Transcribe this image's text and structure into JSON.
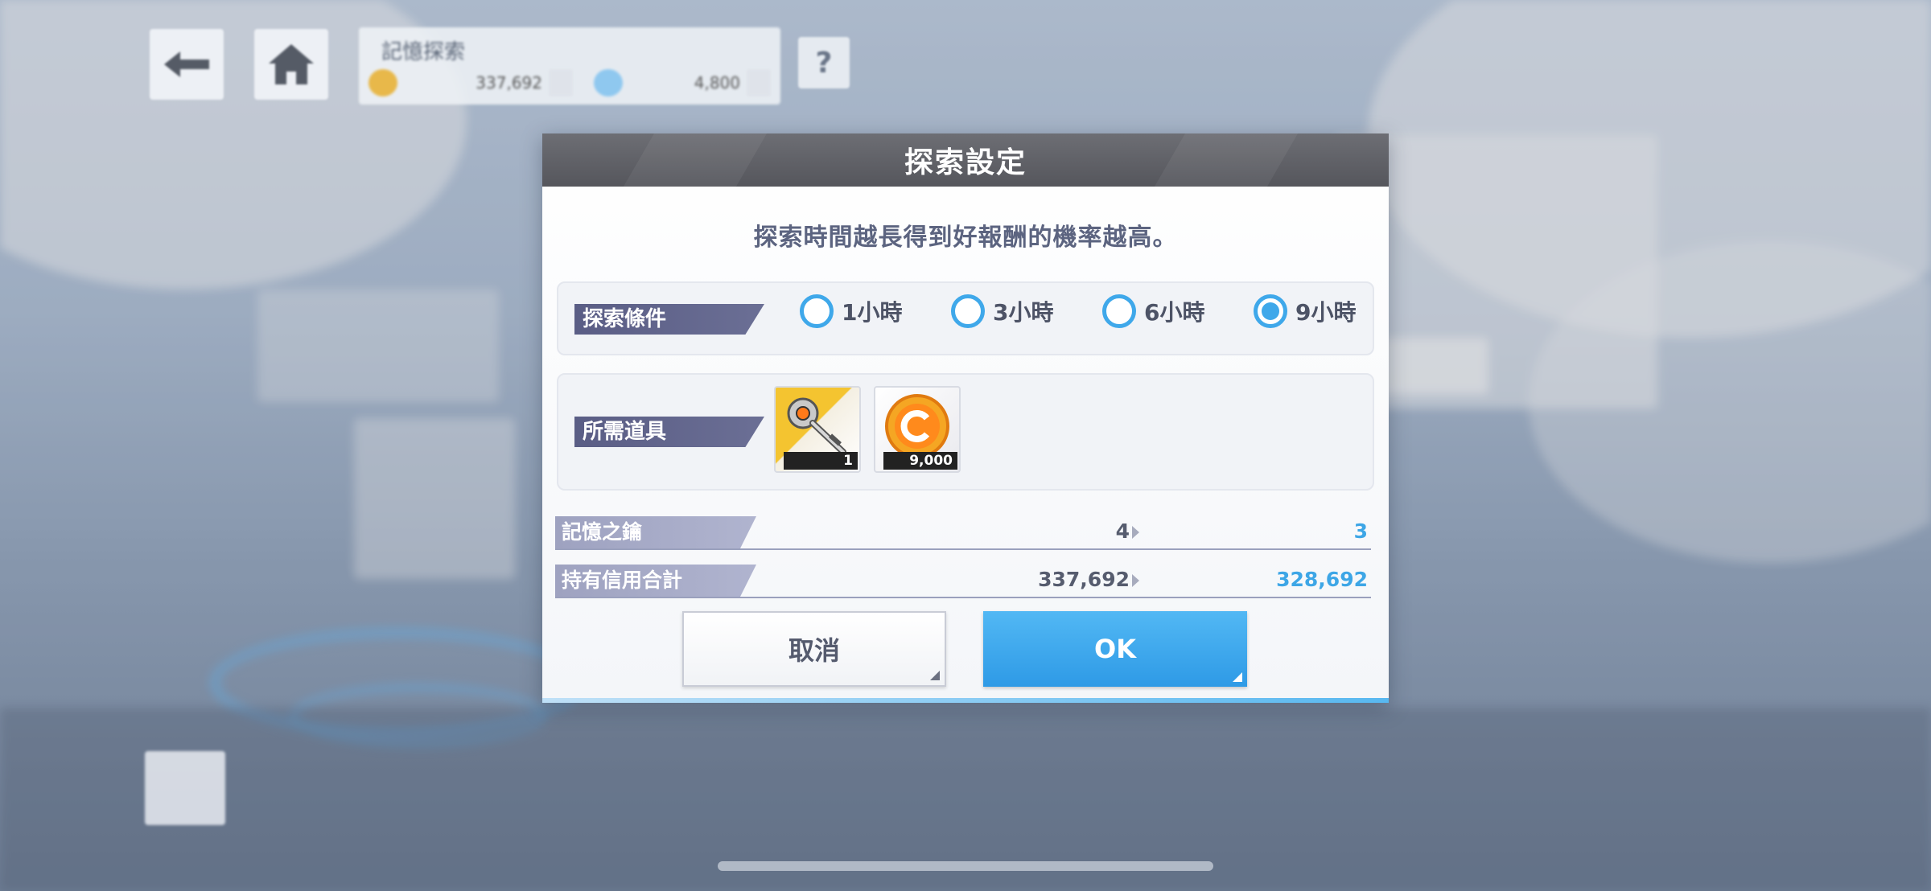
{
  "header": {
    "resource_title": "記憶探索",
    "currency_amount": "337,692",
    "gem_amount": "4,800",
    "help_label": "?"
  },
  "dialog": {
    "title": "探索設定",
    "description": "探索時間越長得到好報酬的機率越高。",
    "condition": {
      "label": "探索條件",
      "options": [
        {
          "label": "1小時",
          "selected": false
        },
        {
          "label": "3小時",
          "selected": false
        },
        {
          "label": "6小時",
          "selected": false
        },
        {
          "label": "9小時",
          "selected": true
        }
      ]
    },
    "required_items": {
      "label": "所需道具",
      "items": [
        {
          "icon": "memory-key-icon",
          "count": "1"
        },
        {
          "icon": "credit-coin-icon",
          "count": "9,000"
        }
      ]
    },
    "stats": [
      {
        "label": "記憶之鑰",
        "before": "4",
        "after": "3"
      },
      {
        "label": "持有信用合計",
        "before": "337,692",
        "after": "328,692"
      }
    ],
    "buttons": {
      "cancel": "取消",
      "ok": "OK"
    }
  },
  "colors": {
    "accent": "#3fa8ea",
    "header": "#5e5f65",
    "tag": "#5e6189"
  }
}
